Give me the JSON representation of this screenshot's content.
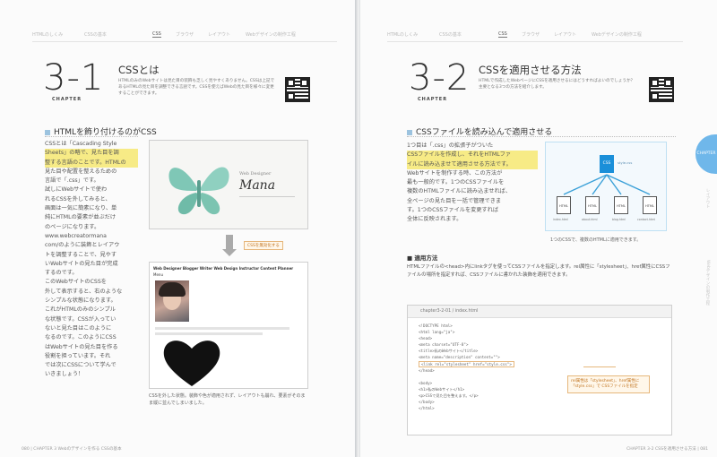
{
  "left_page": {
    "tabs": [
      "HTMLのしくみ",
      "CSSの基本",
      "CSS",
      "ブラウザ",
      "レイアウト",
      "Webデザインの制作工程"
    ],
    "active_tab_index": 2,
    "chapter_number": "3-1",
    "chapter_label": "CHAPTER",
    "section_title": "CSSとは",
    "section_intro": "HTMLのみのWebサイトは見た目の装飾も乏しく見やすくありません。CSSは上記であるHTMLの見た目を調整できる言語です。CSSを使えばWebの見た目を様々に変更することができます。",
    "heading": "HTMLを飾り付けるのがCSS",
    "body_lines": [
      "CSSとは「Cascading Style",
      "Sheets」の略で、見た目を調",
      "整する言語のことです。HTMLの",
      "見た目や配置を整えるための",
      "言語で「.css」です。",
      "試しにWebサイトで使わ",
      "れるCSSを外してみると、",
      "画面は一気に簡素になり、単",
      "純にHTMLの要素が並ぶだけ",
      "のページになります。",
      "www.webcreatormana",
      "com/のように装飾とレイアウ",
      "トを調整することで、見やす",
      "いWebサイトの見た目が完成",
      "するのです。",
      "このWebサイトのCSSを",
      "外して表示すると、右のような",
      "シンプルな状態になります。",
      "これがHTMLのみのシンプル",
      "な状態です。CSSが入ってい",
      "ないと見た目はこのように",
      "なるのです。このようにCSS",
      "はWebサイトの見た目を作る",
      "役割を担っています。それ",
      "では次にCSSについて学んで",
      "いきましょう！"
    ],
    "mock_site_title": "Web Designer",
    "mock_site_name": "Mana",
    "arrow_tag": "CSSを無効化する",
    "mock_nav": "Web Designer Blogger Writer Web Design Instructor Content Planner",
    "mock_sub": "Menu",
    "caption": "CSSを外した状態。装飾や色が適用されず、レイアウトも崩れ、要素がそのまま縦に並んでしまいました。",
    "folio": "080  |  CHAPTER 3  Webのデザインを作る CSSの基本"
  },
  "right_page": {
    "tabs": [
      "HTMLのしくみ",
      "CSSの基本",
      "CSS",
      "ブラウザ",
      "レイアウト",
      "Webデザインの制作工程"
    ],
    "active_tab_index": 2,
    "chapter_number": "3-2",
    "chapter_label": "CHAPTER",
    "section_title": "CSSを適用させる方法",
    "section_intro": "HTMLで作成したWebページにCSSを適用させるにはどうすればよいのでしょうか？ 主要となる3つの方法を紹介します。",
    "heading": "CSSファイルを読み込んで適用させる",
    "body_lines": [
      "1つ目は「.css」の拡張子がついた",
      "CSSファイルを作成し、それをHTMLファ",
      "イルに読み込ませて適用させる方法です。",
      "Webサイトを制作する時、この方法が",
      "最も一般的です。1つのCSSファイルを",
      "複数のHTMLファイルに読み込ませれば、",
      "全ページの見た目を一括で管理できま",
      "す。1つのCSSファイルを変更すれば",
      "全体に反映されます。"
    ],
    "diagram_root": "CSS",
    "diagram_root_note": "style.css",
    "diagram_files": [
      "HTML",
      "HTML",
      "HTML",
      "HTML"
    ],
    "diagram_file_labels": [
      "index.html",
      "about.html",
      "blog.html",
      "contact.html"
    ],
    "diagram_caption": "1つのCSSで、複数のHTMLに適用できます。",
    "subheading": "■ 適用方法",
    "apply_text": "HTMLファイルの<head>内にlinkタグを使ってCSSファイルを指定します。rel属性に「stylesheet」、href属性にCSSファイルの場所を指定すれば、CSSファイルに書かれた装飾を適用できます。",
    "code_title": "chapter3-2-01 / index.html",
    "code_lines": [
      "<!DOCTYPE html>",
      "<html lang=\"ja\">",
      "  <head>",
      "    <meta charset=\"UTF-8\">",
      "    <title>私のWebサイト</title>",
      "    <meta name=\"description\" content=\"\">",
      "    <link rel=\"stylesheet\" href=\"style.css\">",
      "  </head>",
      "",
      "  <body>",
      "    <h1>私のWebサイト</h1>",
      "    <p>CSSで見た目を整えます。</p>",
      "  </body>",
      "</html>"
    ],
    "code_note": "rel属性は「stylesheet」、href属性に「style.css」で CSSファイルを指定",
    "side_tab": "CHAPTER 3",
    "folio": "CHAPTER 3-2  CSSを適用させる方法  |  081"
  },
  "colors": {
    "accent": "#8cc7ee",
    "highlight": "#f7eb86",
    "heading_square": "#9cc3df",
    "tag": "#e6b77c",
    "css_box": "#1a8fd9"
  }
}
